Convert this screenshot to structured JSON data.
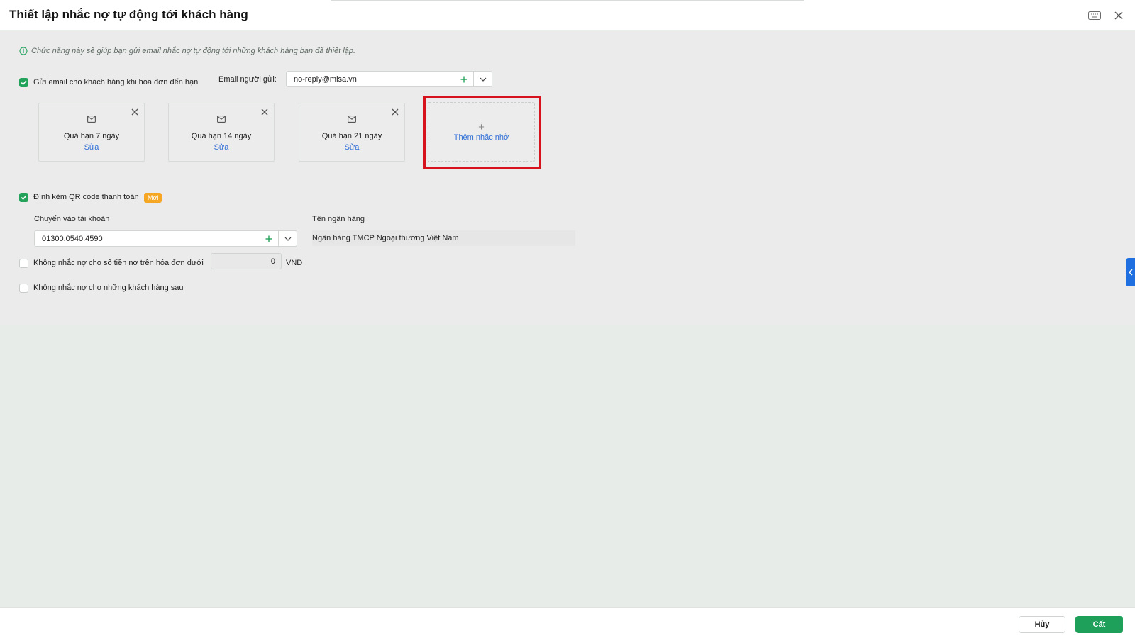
{
  "dialog": {
    "title": "Thiết lập nhắc nợ tự động tới khách hàng",
    "info": "Chức năng này sẽ giúp bạn gửi email nhắc nợ tự động tới những khách hàng bạn đã thiết lập."
  },
  "send_email": {
    "label": "Gửi email cho khách hàng khi hóa đơn đến hạn",
    "checked": true,
    "sender_label": "Email người gửi:",
    "sender_value": "no-reply@misa.vn"
  },
  "reminders": [
    {
      "title": "Quá hạn 7 ngày",
      "edit_label": "Sửa"
    },
    {
      "title": "Quá hạn 14 ngày",
      "edit_label": "Sửa"
    },
    {
      "title": "Quá hạn 21 ngày",
      "edit_label": "Sửa"
    }
  ],
  "add_reminder": {
    "icon": "+",
    "label": "Thêm nhắc nhở"
  },
  "qr": {
    "label": "Đính kèm QR code thanh toán",
    "checked": true,
    "badge": "Mới",
    "account_label": "Chuyển vào tài khoản",
    "account_value": "01300.0540.4590",
    "bank_label": "Tên ngân hàng",
    "bank_value": "Ngân hàng TMCP Ngoại thương Việt Nam"
  },
  "min_amount": {
    "label": "Không nhắc nợ cho số tiền nợ trên hóa đơn dưới",
    "checked": false,
    "value": "0",
    "unit": "VND"
  },
  "exclude_customers": {
    "label": "Không nhắc nợ cho những khách hàng sau",
    "checked": false
  },
  "footer": {
    "cancel_label": "Hủy",
    "save_label": "Cất"
  },
  "colors": {
    "primary_green": "#1ea05a",
    "link_blue": "#2f6fd6",
    "highlight_red": "#d6131c",
    "badge_orange": "#f5a623"
  }
}
